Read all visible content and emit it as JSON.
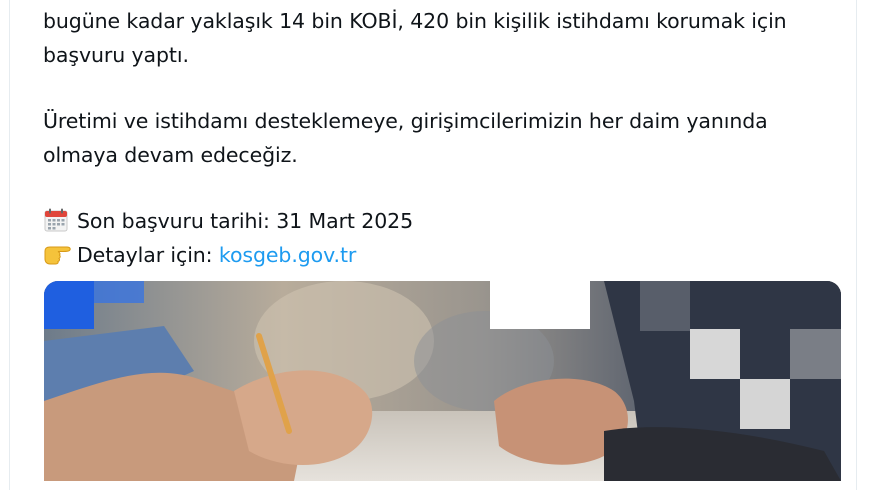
{
  "tweet": {
    "line1": "bugüne kadar yaklaşık 14 bin KOBİ, 420 bin kişilik istihdamı korumak için",
    "line2": "başvuru yaptı.",
    "line3": "Üretimi ve istihdamı desteklemeye, girişimcilerimizin her daim yanında",
    "line4": "olmaya devam edeceğiz.",
    "deadline_icon": "calendar-icon",
    "deadline_text": "Son başvuru tarihi: 31 Mart 2025",
    "details_icon": "pointing-hand-icon",
    "details_prefix": "Detaylar için: ",
    "details_link": "kosgeb.gov.tr"
  },
  "media": {
    "description_icon": "photo-hands-writing"
  }
}
